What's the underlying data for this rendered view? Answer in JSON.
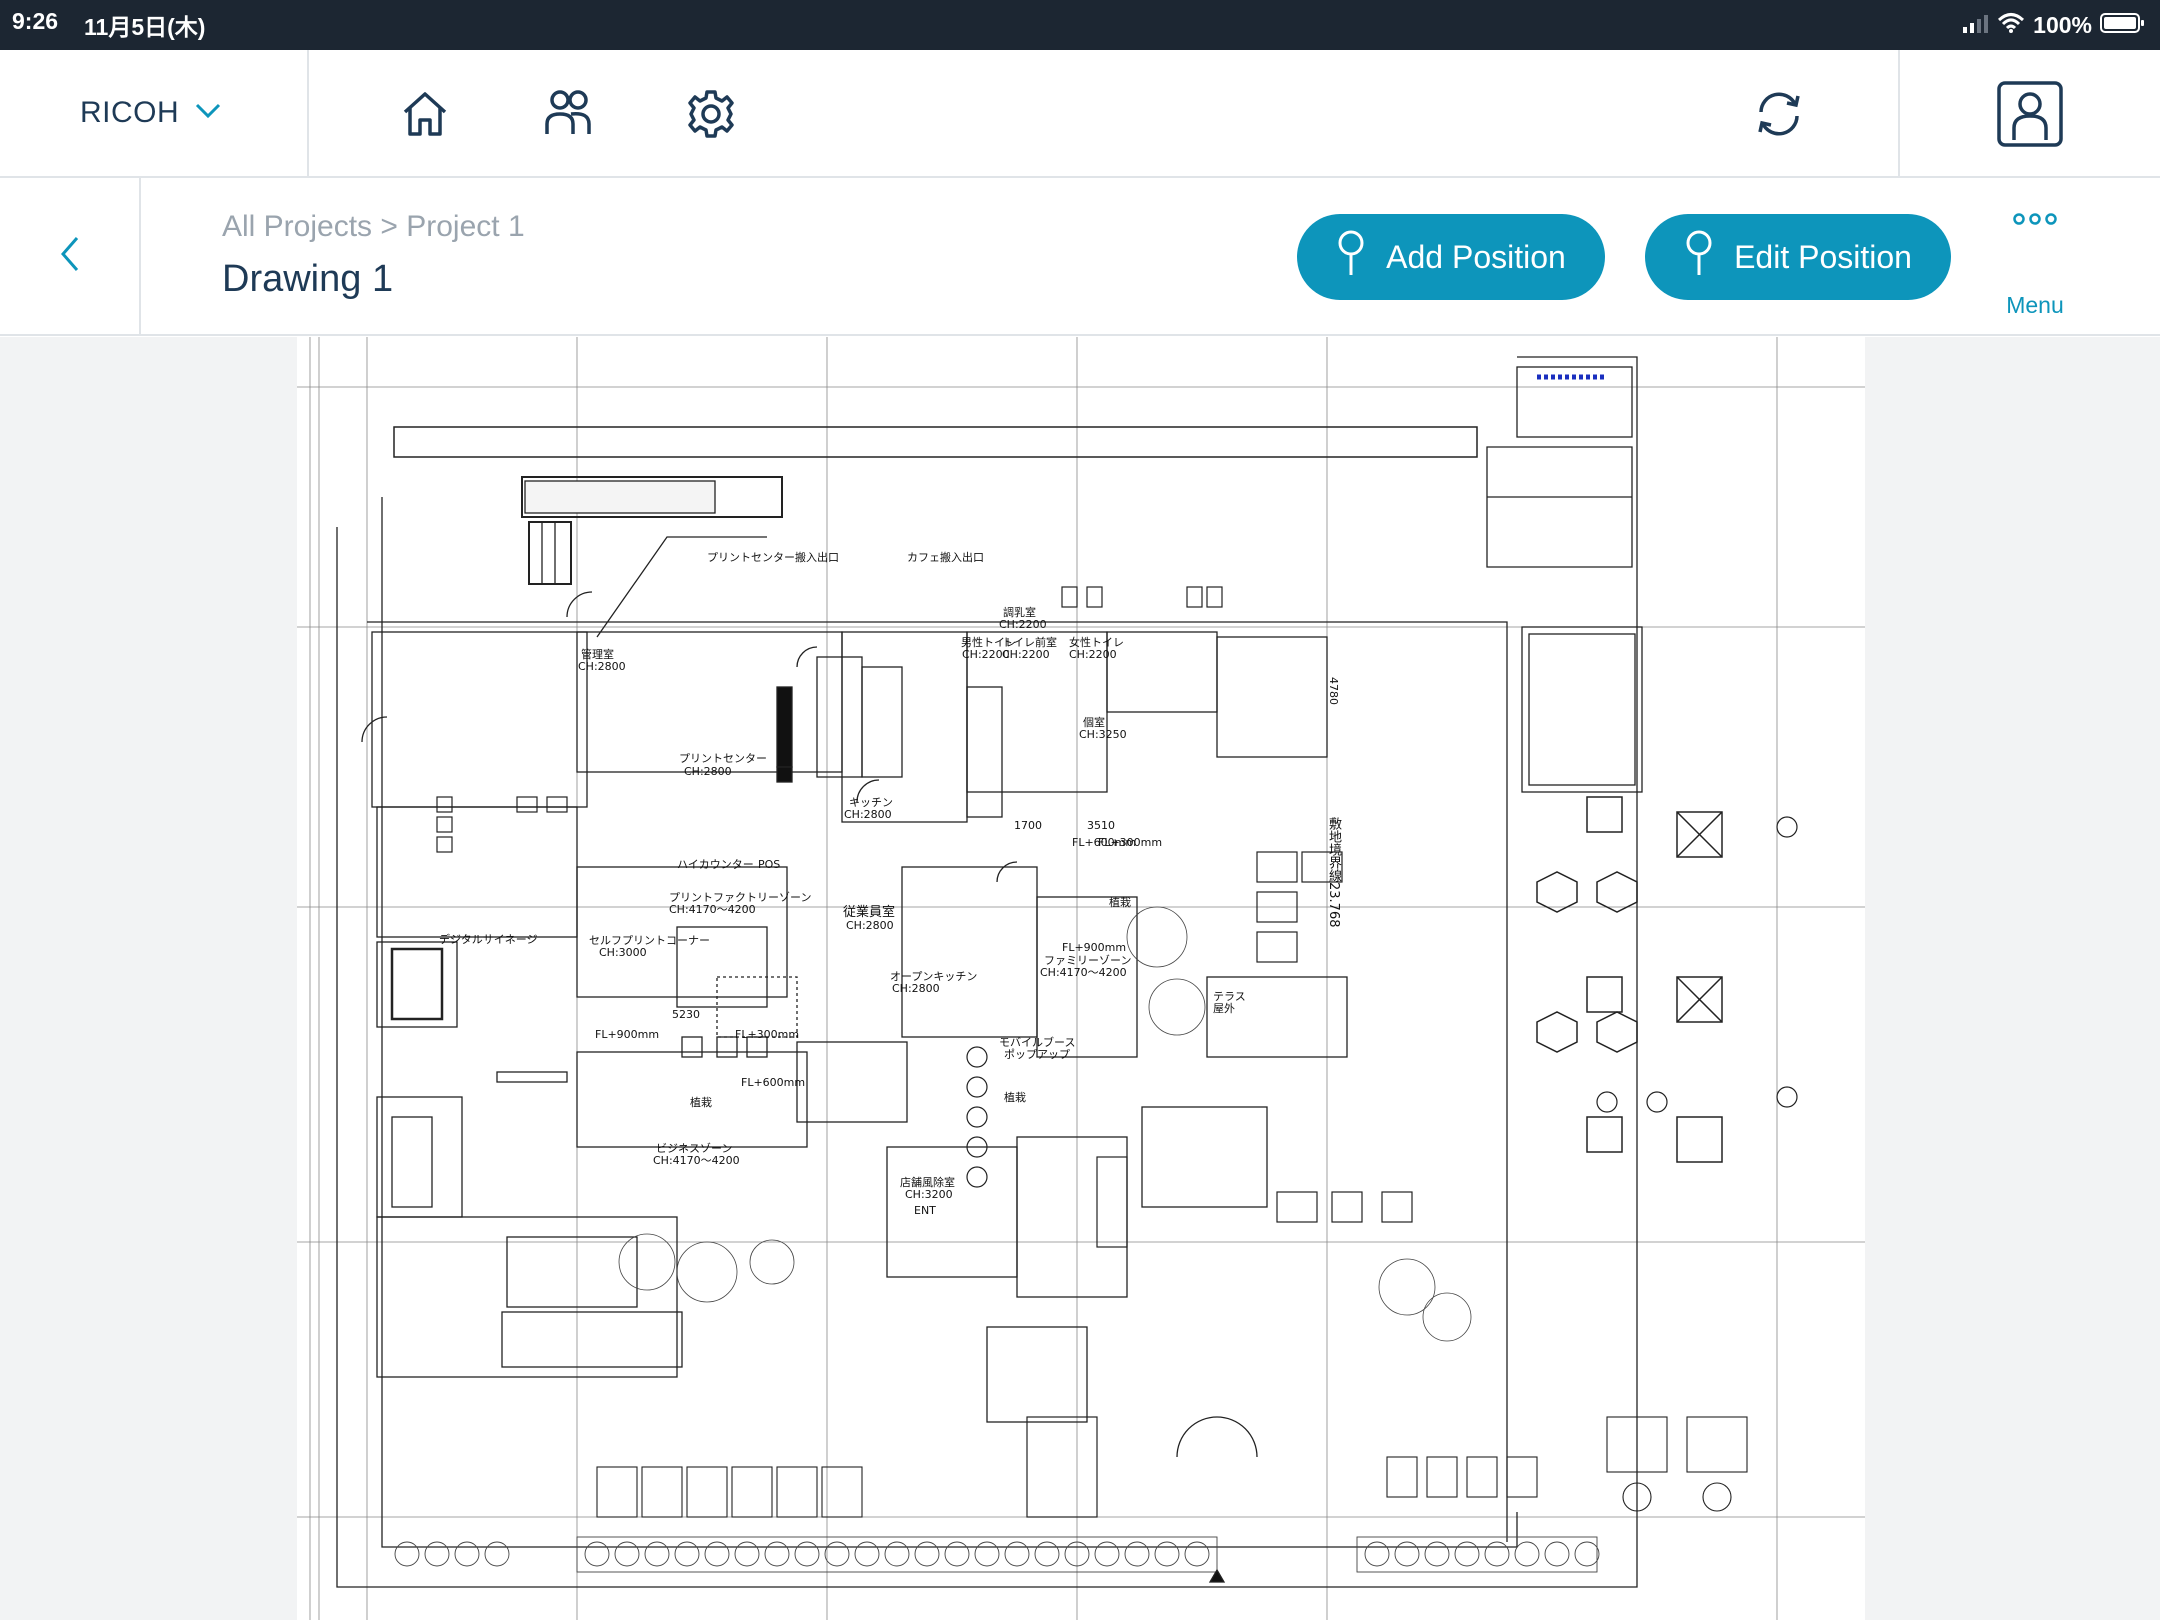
{
  "status_bar": {
    "time": "9:26",
    "date": "11月5日(木)",
    "battery": "100%"
  },
  "toolbar": {
    "org_name": "RICOH",
    "icons": [
      "home-icon",
      "people-icon",
      "gear-icon",
      "sync-icon",
      "user-profile-icon"
    ]
  },
  "header": {
    "breadcrumb": "All Projects > Project 1",
    "title": "Drawing 1",
    "add_position_label": "Add Position",
    "edit_position_label": "Edit Position",
    "menu_label": "Menu"
  },
  "colors": {
    "accent": "#0d95bb",
    "status_bar": "#1c2632",
    "title_text": "#1e3a56",
    "breadcrumb_text": "#9aa4ae"
  },
  "drawing": {
    "rooms": {
      "office": "管理室",
      "office_ch": "CH:2800",
      "print_center": "プリントセンター",
      "print_center_ch": "CH:2800",
      "nursing_room": "調乳室",
      "nursing_room_ch": "CH:2200",
      "mens_toilet": "男性トイレ",
      "mens_toilet_ch": "CH:2200",
      "toilet_front": "トイレ前室",
      "toilet_front_ch": "CH:2200",
      "womens_toilet": "女性トイレ",
      "womens_toilet_ch": "CH:2200",
      "private_room": "個室",
      "private_room_ch": "CH:3250",
      "kitchen": "キッチン",
      "kitchen_ch": "CH:2800",
      "high_counter": "ハイカウンター",
      "pos": "POS",
      "print_factory": "プリントファクトリーゾーン",
      "print_factory_ch": "CH:4170～4200",
      "self_print": "セルフプリントコーナー",
      "self_print_ch": "CH:3000",
      "staff_room": "従業員室",
      "staff_room_ch": "CH:2800",
      "open_kitchen": "オープンキッチン",
      "open_kitchen_ch": "CH:2800",
      "family_zone": "ファミリーゾーン",
      "family_zone_ch": "CH:4170～4200",
      "terrace": "テラス",
      "terrace_outdoor": "屋外",
      "digital_signage": "デジタルサイネージ",
      "business_zone": "ビジネスゾーン",
      "business_zone_ch": "CH:4170～4200",
      "windbreak_room": "店舗風除室",
      "windbreak_room_ch": "CH:3200",
      "planting": "植栽",
      "mobile_booth": "モバイルブース",
      "popup": "ポップアップ",
      "boundary": "敷地境界線23.768",
      "ent": "ENT",
      "print_center_entrance": "プリントセンター搬入出口",
      "cafe_entrance": "カフェ搬入出口",
      "fl_900": "FL+900mm",
      "fl_300": "FL+300mm",
      "fl_600": "FL+600mm",
      "dim_5230": "5230",
      "dim_3510": "3510",
      "dim_1700": "1700",
      "dim_4780": "4780"
    }
  }
}
